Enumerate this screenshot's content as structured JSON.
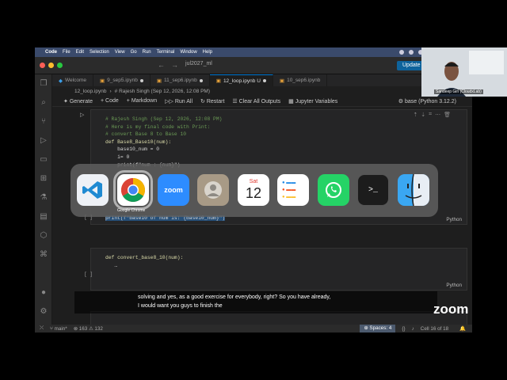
{
  "menubar": {
    "app": "Code",
    "items": [
      "File",
      "Edit",
      "Selection",
      "View",
      "Go",
      "Run",
      "Terminal",
      "Window",
      "Help"
    ]
  },
  "window": {
    "search": "jul2027_ml",
    "update_label": "Update"
  },
  "tabs": [
    {
      "label": "Welcome",
      "modified": false
    },
    {
      "label": "9_sep5.ipynb",
      "modified": true
    },
    {
      "label": "11_sep6.ipynb",
      "modified": true
    },
    {
      "label": "12_loop.ipynb U",
      "modified": true
    },
    {
      "label": "10_sep6.ipynb",
      "modified": false
    }
  ],
  "breadcrumb": {
    "file": "12_loop.ipynb",
    "cell": "# Rajesh Singh (Sep 12, 2026, 12:08 PM)"
  },
  "toolbar": {
    "generate": "Generate",
    "code": "+ Code",
    "markdown": "+ Markdown",
    "run_all": "Run All",
    "restart": "Restart",
    "clear": "Clear All Outputs",
    "variables": "Jupyter Variables",
    "kernel": "base (Python 3.12.2)"
  },
  "cell1": {
    "lines": [
      "# Rajesh Singh (Sep 12, 2026, 12:08 PM)",
      "# Here is my final code with Print:",
      "# convert Base 8 to Base 10",
      "def Base8_Base10(num):",
      "    base10_num = 0",
      "    i= 0",
      "    print(f\"num : {num}\")"
    ],
    "highlighted": "print(f\"base10 of num is: {base10_num}\")",
    "language": "Python",
    "bracket": "[ ]"
  },
  "cell2": {
    "line": "def convert_base8_10(num):",
    "ellipsis": "…",
    "language": "Python",
    "bracket": "[ ]"
  },
  "dock": {
    "selected_label": "Google Chrome",
    "apps": [
      "VS Code",
      "Google Chrome",
      "Zoom",
      "Contacts",
      "Calendar",
      "Reminders",
      "WhatsApp",
      "Terminal",
      "Finder"
    ],
    "calendar_month": "Sat",
    "calendar_day": "12",
    "zoom_text": "zoom"
  },
  "status": {
    "branch": "main*",
    "errors": "163",
    "warnings": "132",
    "spaces": "Spaces: 4",
    "cell": "Cell 16 of 18"
  },
  "captions": {
    "line1": "solving and yes, as a good exercise for everybody, right? So you have already,",
    "line2": "I would want you guys to finish the"
  },
  "zoom_watermark": "zoom",
  "webcam_label": "Sandeep Giri (CloudxLab)"
}
